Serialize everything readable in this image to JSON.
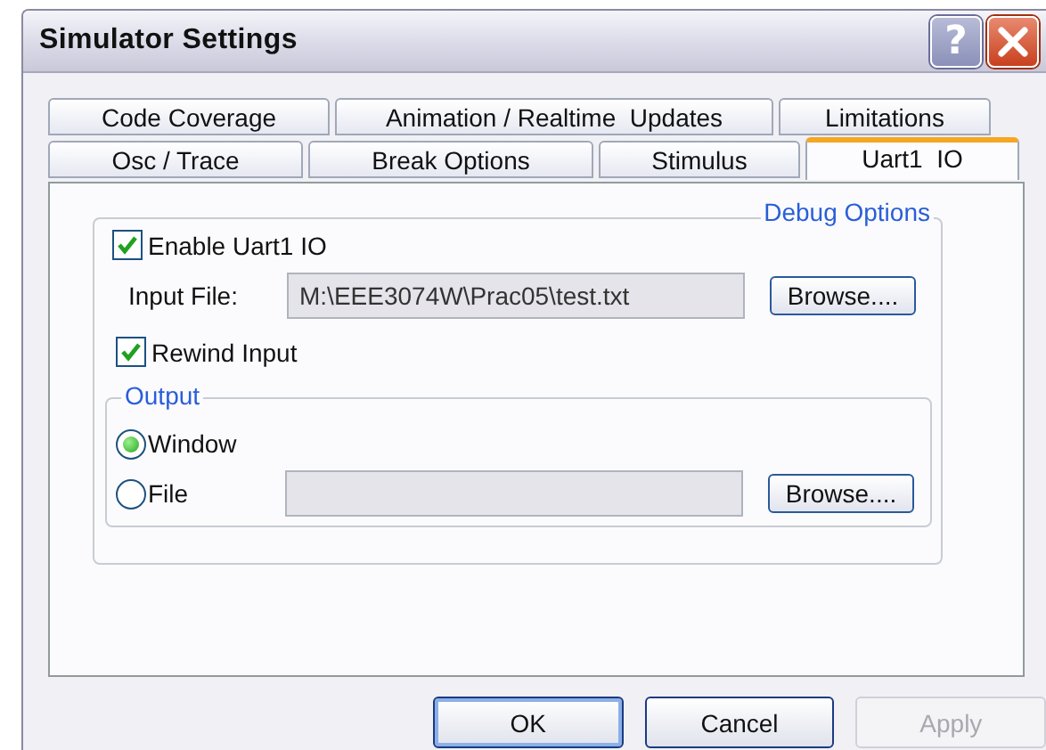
{
  "window": {
    "title": "Simulator Settings",
    "help": "?"
  },
  "tab_rows": [
    [
      {
        "label": "Code Coverage",
        "selected": false
      },
      {
        "label": "Animation / Realtime  Updates",
        "selected": false
      },
      {
        "label": "Limitations",
        "selected": false
      }
    ],
    [
      {
        "label": "Osc / Trace",
        "selected": false
      },
      {
        "label": "Break Options",
        "selected": false
      },
      {
        "label": "Stimulus",
        "selected": false
      },
      {
        "label": "Uart1  IO",
        "selected": true
      }
    ]
  ],
  "debug_options": {
    "title": "Debug Options",
    "enable": {
      "label": "Enable Uart1 IO",
      "checked": true
    },
    "input_file": {
      "label": "Input  File:",
      "value": "M:\\EEE3074W\\Prac05\\test.txt",
      "browse": "Browse...."
    },
    "rewind": {
      "label": "Rewind Input",
      "checked": true
    },
    "output": {
      "title": "Output",
      "options": [
        {
          "label": "Window",
          "selected": true
        },
        {
          "label": "File",
          "selected": false
        }
      ],
      "browse": "Browse...."
    }
  },
  "buttons": [
    {
      "label": "OK",
      "disabled": false,
      "default": true
    },
    {
      "label": "Cancel",
      "disabled": false,
      "default": false
    },
    {
      "label": "Apply",
      "disabled": true,
      "default": false
    }
  ]
}
